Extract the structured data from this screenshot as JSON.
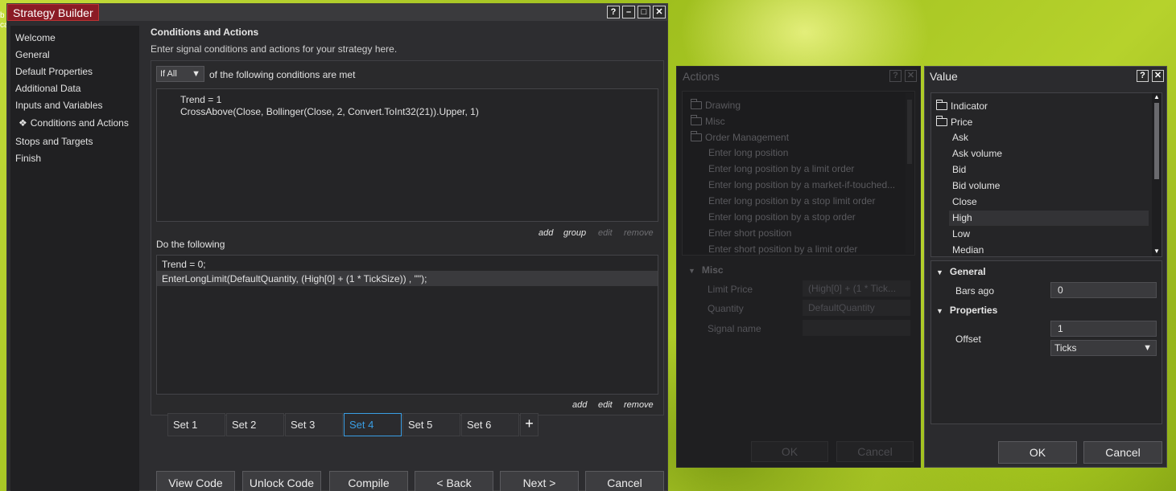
{
  "desktop": {
    "text": "b\nca"
  },
  "strategy_builder": {
    "title": "Strategy Builder",
    "window_buttons": {
      "help": "?",
      "minimize": "–",
      "maximize": "□",
      "close": "✕"
    },
    "sidebar": [
      "Welcome",
      "General",
      "Default Properties",
      "Additional Data",
      "Inputs and Variables",
      "Conditions and Actions",
      "Stops and Targets",
      "Finish"
    ],
    "active_sidebar_marker": "❖",
    "heading": "Conditions and Actions",
    "subheading": "Enter signal conditions and actions for your strategy here.",
    "conditions": {
      "mode": "If All",
      "mode_suffix": "of the following conditions are met",
      "lines": [
        "Trend = 1",
        "CrossAbove(Close, Bollinger(Close, 2, Convert.ToInt32(21)).Upper, 1)"
      ],
      "links": {
        "add": "add",
        "group": "group",
        "edit": "edit",
        "remove": "remove"
      }
    },
    "actions": {
      "label": "Do the following",
      "lines": [
        "Trend = 0;",
        "EnterLongLimit(DefaultQuantity, (High[0] + (1 * TickSize)) , \"\");"
      ],
      "links": {
        "add": "add",
        "edit": "edit",
        "remove": "remove"
      }
    },
    "sets": [
      "Set 1",
      "Set 2",
      "Set 3",
      "Set 4",
      "Set 5",
      "Set 6"
    ],
    "active_set": "Set 4",
    "add_set": "+",
    "buttons": [
      "View Code",
      "Unlock Code",
      "Compile",
      "< Back",
      "Next >",
      "Cancel"
    ]
  },
  "actions_window": {
    "title": "Actions",
    "help": "?",
    "close": "✕",
    "folders": [
      "Drawing",
      "Misc",
      "Order Management"
    ],
    "items": [
      "Enter long position",
      "Enter long position by a limit order",
      "Enter long position by a market-if-touched...",
      "Enter long position by a stop limit order",
      "Enter long position by a stop order",
      "Enter short position",
      "Enter short position by a limit order"
    ],
    "section": "Misc",
    "properties": [
      {
        "name": "Limit Price",
        "value": "(High[0] + (1 * Tick..."
      },
      {
        "name": "Quantity",
        "value": "DefaultQuantity"
      },
      {
        "name": "Signal name",
        "value": ""
      }
    ],
    "ok": "OK",
    "cancel": "Cancel"
  },
  "value_window": {
    "title": "Value",
    "help": "?",
    "close": "✕",
    "folders": [
      "Indicator",
      "Price"
    ],
    "items": [
      "Ask",
      "Ask volume",
      "Bid",
      "Bid volume",
      "Close",
      "High",
      "Low",
      "Median"
    ],
    "selected_item": "High",
    "general_section": "General",
    "bars_ago_label": "Bars ago",
    "bars_ago_value": "0",
    "properties_section": "Properties",
    "offset_label": "Offset",
    "offset_value": "1",
    "offset_unit": "Ticks",
    "ok": "OK",
    "cancel": "Cancel"
  },
  "colors": {
    "accent": "#3a9ee4",
    "title_tab": "#8b1b25"
  }
}
